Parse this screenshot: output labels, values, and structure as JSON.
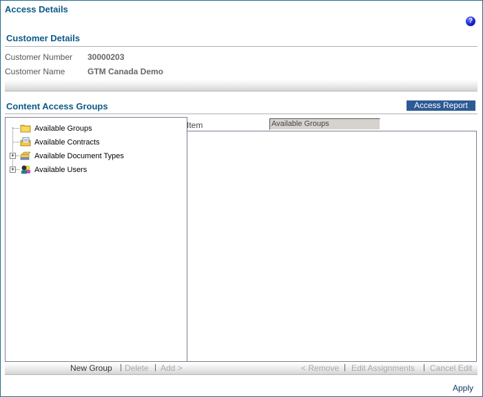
{
  "page": {
    "title": "Access Details",
    "help_icon": "help-icon"
  },
  "customer_details": {
    "title": "Customer Details",
    "fields": [
      {
        "label": "Customer Number",
        "value": "30000203"
      },
      {
        "label": "Customer Name",
        "value": "GTM Canada Demo"
      }
    ]
  },
  "content_access_groups": {
    "title": "Content Access Groups",
    "report_button": "Access Report",
    "tree": [
      {
        "label": "Available Groups",
        "icon": "folder-icon",
        "expandable": false
      },
      {
        "label": "Available Contracts",
        "icon": "contract-icon",
        "expandable": false
      },
      {
        "label": "Available Document Types",
        "icon": "document-types-icon",
        "expandable": true
      },
      {
        "label": "Available Users",
        "icon": "users-icon",
        "expandable": true
      }
    ],
    "item_label": "Item",
    "item_value": "Available Groups",
    "expand_glyph": "+"
  },
  "actions": {
    "left": [
      {
        "label": "New Group",
        "enabled": true
      },
      {
        "label": "Delete",
        "enabled": false
      },
      {
        "label": "Add >",
        "enabled": false
      }
    ],
    "right": [
      {
        "label": "< Remove",
        "enabled": false
      },
      {
        "label": "Edit Assignments",
        "enabled": false
      },
      {
        "label": "Cancel Edit",
        "enabled": false
      }
    ],
    "separator": "|",
    "apply": "Apply"
  },
  "colors": {
    "title": "#0b5a86",
    "report_button_bg": "#2c5a94",
    "border": "#1f6a8c",
    "disabled_text": "#a8a8a8"
  }
}
